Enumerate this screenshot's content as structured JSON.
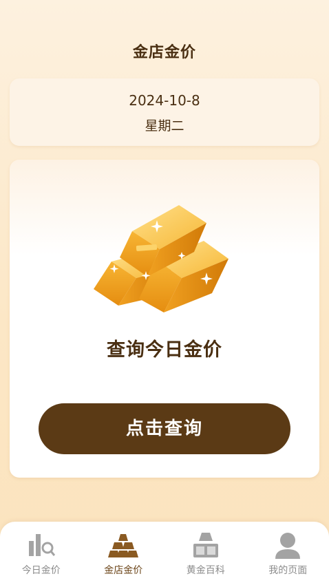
{
  "header": {
    "title": "金店金价"
  },
  "date_card": {
    "date": "2024-10-8",
    "weekday": "星期二"
  },
  "main_card": {
    "heading": "查询今日金价",
    "button_label": "点击查询"
  },
  "tabbar": {
    "active_color": "#6b4418",
    "inactive_color": "#8c8c8c",
    "items": [
      {
        "label": "今日金价",
        "icon": "chart-search-icon"
      },
      {
        "label": "金店金价",
        "icon": "gold-bars-stack-icon"
      },
      {
        "label": "黄金百科",
        "icon": "gold-encyclopedia-icon"
      },
      {
        "label": "我的页面",
        "icon": "user-profile-icon"
      }
    ]
  },
  "colors": {
    "brand_brown": "#5b3a15",
    "text_dark": "#4a2f12",
    "gold": "#f2a623"
  }
}
